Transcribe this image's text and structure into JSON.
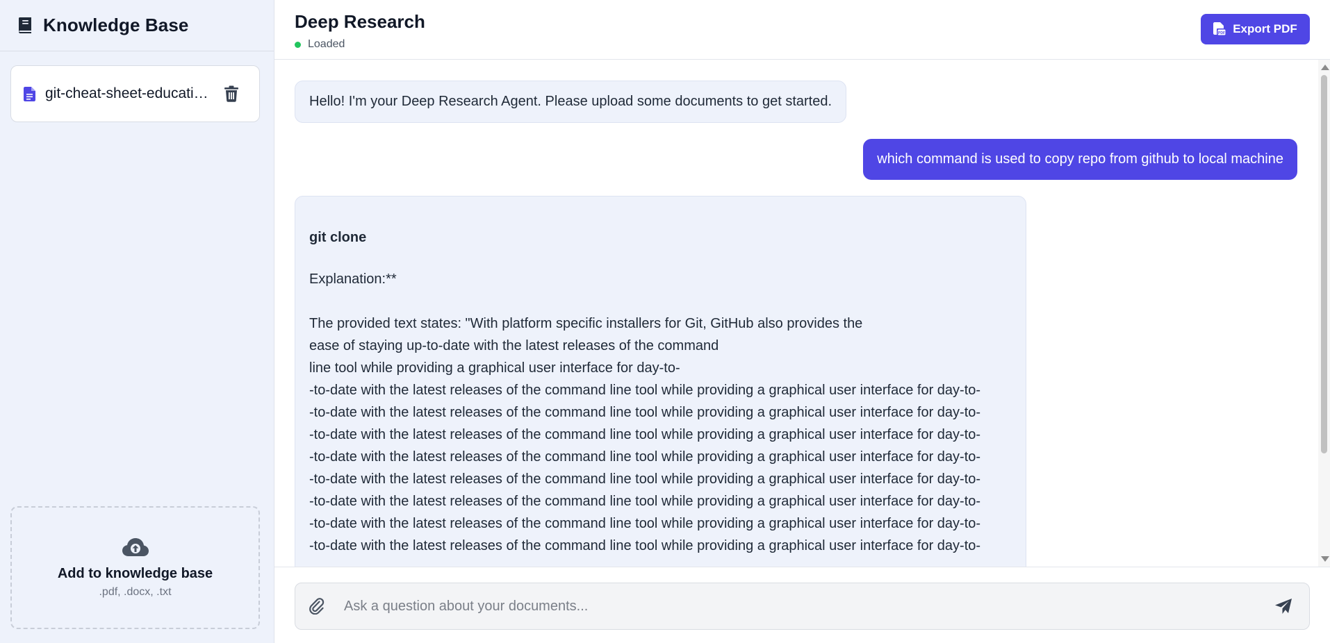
{
  "sidebar": {
    "title": "Knowledge Base",
    "documents": [
      {
        "name": "git-cheat-sheet-education.pdf"
      }
    ],
    "upload": {
      "title": "Add to knowledge base",
      "formats": ".pdf, .docx, .txt"
    }
  },
  "header": {
    "title": "Deep Research",
    "status": "Loaded",
    "status_color": "#22c55e",
    "export_label": "Export PDF"
  },
  "colors": {
    "accent": "#4f46e5",
    "sidebar_bg": "#eef2fb"
  },
  "chat": {
    "messages": [
      {
        "role": "assistant",
        "text": "Hello! I'm your Deep Research Agent. Please upload some documents to get started."
      },
      {
        "role": "user",
        "text": "which command is used to copy repo from github to local machine"
      },
      {
        "role": "assistant",
        "heading": "git clone",
        "explanation": "Explanation:**",
        "lines": [
          "The provided text states: \"With platform specific installers for Git, GitHub also provides the",
          "ease of staying up-to-date with the latest releases of the command",
          "line tool while providing a graphical user interface for day-to-",
          "-to-date with the latest releases of the command line tool while providing a graphical user interface for day-to-",
          "-to-date with the latest releases of the command line tool while providing a graphical user interface for day-to-",
          "-to-date with the latest releases of the command line tool while providing a graphical user interface for day-to-",
          "-to-date with the latest releases of the command line tool while providing a graphical user interface for day-to-",
          "-to-date with the latest releases of the command line tool while providing a graphical user interface for day-to-",
          "-to-date with the latest releases of the command line tool while providing a graphical user interface for day-to-",
          "-to-date with the latest releases of the command line tool while providing a graphical user interface for day-to-",
          "-to-date with the latest releases of the command line tool while providing a graphical user interface for day-to-"
        ]
      }
    ]
  },
  "composer": {
    "placeholder": "Ask a question about your documents...",
    "value": ""
  },
  "icons": {
    "sidebar_header": "book-icon",
    "document": "file-icon",
    "delete": "trash-icon",
    "upload": "cloud-upload-icon",
    "export": "pdf-file-icon",
    "attach": "paperclip-icon",
    "send": "send-icon"
  }
}
